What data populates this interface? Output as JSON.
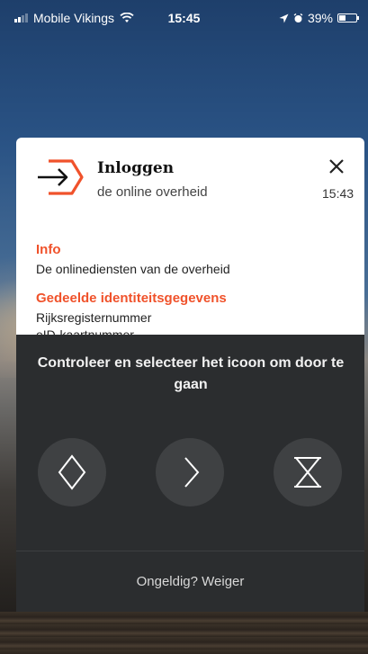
{
  "status_bar": {
    "carrier": "Mobile Vikings",
    "time": "15:45",
    "battery": "39%",
    "battery_level": 0.39,
    "icons": [
      "signal-icon",
      "wifi-icon",
      "location-arrow-icon",
      "alarm-icon",
      "battery-icon"
    ]
  },
  "notification": {
    "title": "Inloggen",
    "subtitle": "de online overheid",
    "time": "15:43",
    "info_heading": "Info",
    "info_text": "De onlinediensten van de overheid",
    "shared_heading": "Gedeelde identiteitsgegevens",
    "shared_items": [
      "Rijksregisternummer",
      "eID-kaartnummer"
    ],
    "accent_color": "#f0522b"
  },
  "challenge": {
    "prompt": "Controleer en selecteer het icoon om door te gaan",
    "options": [
      {
        "icon": "diamond-icon"
      },
      {
        "icon": "chevron-right-icon"
      },
      {
        "icon": "hourglass-icon"
      }
    ],
    "reject_label": "Ongeldig? Weiger"
  }
}
